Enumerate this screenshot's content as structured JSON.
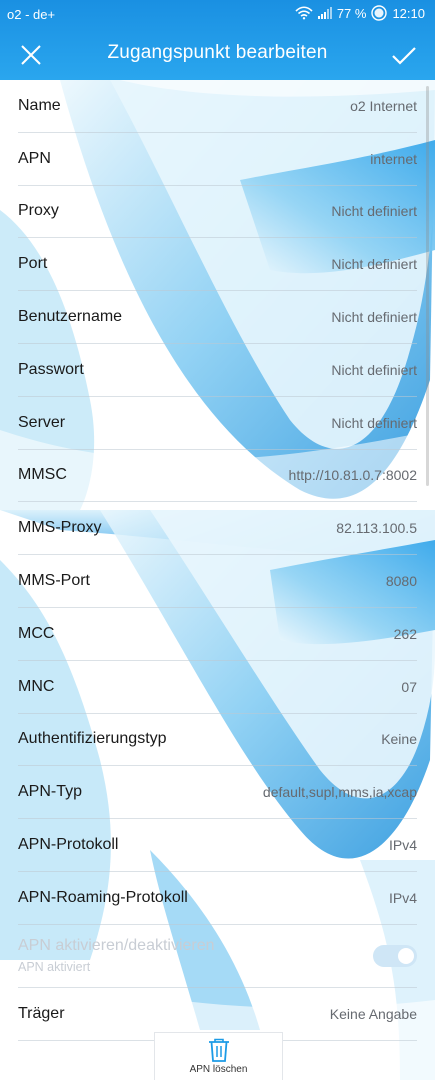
{
  "status_bar": {
    "carrier": "o2 - de+",
    "battery": "77 %",
    "time": "12:10"
  },
  "header": {
    "title": "Zugangspunkt bearbeiten",
    "close_icon": "close-icon",
    "confirm_icon": "checkmark-icon"
  },
  "fields": [
    {
      "label": "Name",
      "value": "o2 Internet"
    },
    {
      "label": "APN",
      "value": "internet"
    },
    {
      "label": "Proxy",
      "value": "Nicht definiert"
    },
    {
      "label": "Port",
      "value": "Nicht definiert"
    },
    {
      "label": "Benutzername",
      "value": "Nicht definiert"
    },
    {
      "label": "Passwort",
      "value": "Nicht definiert"
    },
    {
      "label": "Server",
      "value": "Nicht definiert"
    },
    {
      "label": "MMSC",
      "value": "http://10.81.0.7:8002"
    },
    {
      "label": "MMS-Proxy",
      "value": "82.113.100.5"
    },
    {
      "label": "MMS-Port",
      "value": "8080"
    },
    {
      "label": "MCC",
      "value": "262"
    },
    {
      "label": "MNC",
      "value": "07"
    },
    {
      "label": "Authentifizierungstyp",
      "value": "Keine"
    },
    {
      "label": "APN-Typ",
      "value": "default,supl,mms,ia,xcap"
    },
    {
      "label": "APN-Protokoll",
      "value": "IPv4"
    },
    {
      "label": "APN-Roaming-Protokoll",
      "value": "IPv4"
    }
  ],
  "apn_toggle": {
    "label": "APN aktivieren/deaktivieren",
    "sublabel": "APN aktiviert",
    "enabled": true
  },
  "carrier_field": {
    "label": "Träger",
    "value": "Keine Angabe"
  },
  "bottom_bar": {
    "delete_label": "APN löschen",
    "delete_icon": "trash-icon"
  },
  "colors": {
    "accent": "#1c9be6",
    "wallpaper_light": "#bfe4f7",
    "wallpaper_dark": "#1b8fdb"
  }
}
